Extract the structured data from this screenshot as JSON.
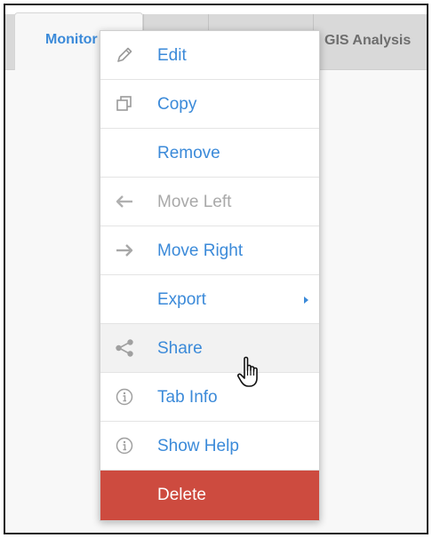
{
  "tabs": {
    "active_label": "Monitor",
    "gis_label": "GIS Analysis"
  },
  "menu": {
    "items": [
      {
        "id": "edit",
        "label": "Edit",
        "icon": "pencil-icon",
        "state": "enabled"
      },
      {
        "id": "copy",
        "label": "Copy",
        "icon": "copy-icon",
        "state": "enabled"
      },
      {
        "id": "remove",
        "label": "Remove",
        "icon": "",
        "state": "enabled"
      },
      {
        "id": "move-left",
        "label": "Move Left",
        "icon": "arrow-left-icon",
        "state": "disabled"
      },
      {
        "id": "move-right",
        "label": "Move Right",
        "icon": "arrow-right-icon",
        "state": "enabled"
      },
      {
        "id": "export",
        "label": "Export",
        "icon": "",
        "state": "enabled",
        "submenu": true
      },
      {
        "id": "share",
        "label": "Share",
        "icon": "share-icon",
        "state": "hover"
      },
      {
        "id": "tab-info",
        "label": "Tab Info",
        "icon": "info-icon",
        "state": "enabled"
      },
      {
        "id": "show-help",
        "label": "Show Help",
        "icon": "info-icon",
        "state": "enabled"
      },
      {
        "id": "delete",
        "label": "Delete",
        "icon": "",
        "state": "danger"
      }
    ]
  },
  "colors": {
    "link_blue": "#3b8ad9",
    "delete_red": "#cd4b3f",
    "disabled_gray": "#a9a9a9",
    "icon_gray": "#9a9a9a"
  }
}
